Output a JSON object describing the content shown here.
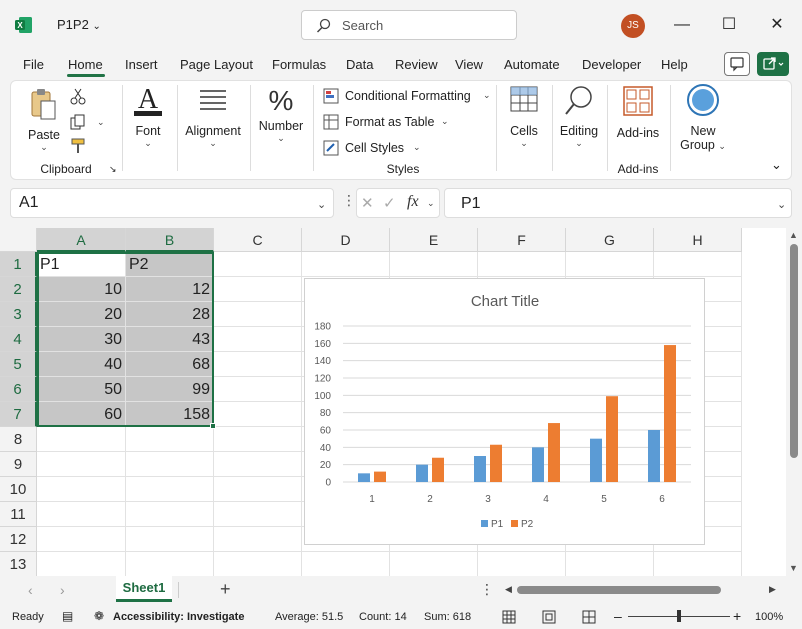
{
  "app": {
    "file_name": "P1P2",
    "search_placeholder": "Search",
    "user_initials": "JS"
  },
  "menu": {
    "tabs": [
      "File",
      "Home",
      "Insert",
      "Page Layout",
      "Formulas",
      "Data",
      "Review",
      "View",
      "Automate",
      "Developer",
      "Help"
    ],
    "active": "Home"
  },
  "ribbon": {
    "clipboard": {
      "paste": "Paste",
      "group": "Clipboard"
    },
    "font": {
      "label": "Font"
    },
    "alignment": {
      "label": "Alignment"
    },
    "number": {
      "label": "Number"
    },
    "styles": {
      "conditional": "Conditional Formatting",
      "format_table": "Format as Table",
      "cell_styles": "Cell Styles",
      "group": "Styles"
    },
    "cells": {
      "label": "Cells"
    },
    "editing": {
      "label": "Editing"
    },
    "addins": {
      "label": "Add-ins",
      "group": "Add-ins"
    },
    "new_group": {
      "line1": "New",
      "line2": "Group"
    }
  },
  "formula_bar": {
    "name_box": "A1",
    "formula": "P1"
  },
  "grid": {
    "columns": [
      "A",
      "B",
      "C",
      "D",
      "E",
      "F",
      "G",
      "H"
    ],
    "rows": [
      "1",
      "2",
      "3",
      "4",
      "5",
      "6",
      "7",
      "8",
      "9",
      "10",
      "11",
      "12",
      "13"
    ],
    "headers": [
      "P1",
      "P2"
    ],
    "values": [
      [
        10,
        12
      ],
      [
        20,
        28
      ],
      [
        30,
        43
      ],
      [
        40,
        68
      ],
      [
        50,
        99
      ],
      [
        60,
        158
      ]
    ]
  },
  "chart_data": {
    "type": "bar",
    "title": "Chart Title",
    "categories": [
      "1",
      "2",
      "3",
      "4",
      "5",
      "6"
    ],
    "series": [
      {
        "name": "P1",
        "values": [
          10,
          20,
          30,
          40,
          50,
          60
        ],
        "color": "#5b9bd5"
      },
      {
        "name": "P2",
        "values": [
          12,
          28,
          43,
          68,
          99,
          158
        ],
        "color": "#ed7d31"
      }
    ],
    "ylim": [
      0,
      180
    ],
    "yticks": [
      "0",
      "20",
      "40",
      "60",
      "80",
      "100",
      "120",
      "140",
      "160",
      "180"
    ],
    "grid": true,
    "legend": "bottom"
  },
  "sheets": {
    "active": "Sheet1"
  },
  "status": {
    "ready": "Ready",
    "accessibility": "Accessibility: Investigate",
    "average": "Average: 51.5",
    "count": "Count: 14",
    "sum": "Sum: 618",
    "zoom": "100%"
  }
}
